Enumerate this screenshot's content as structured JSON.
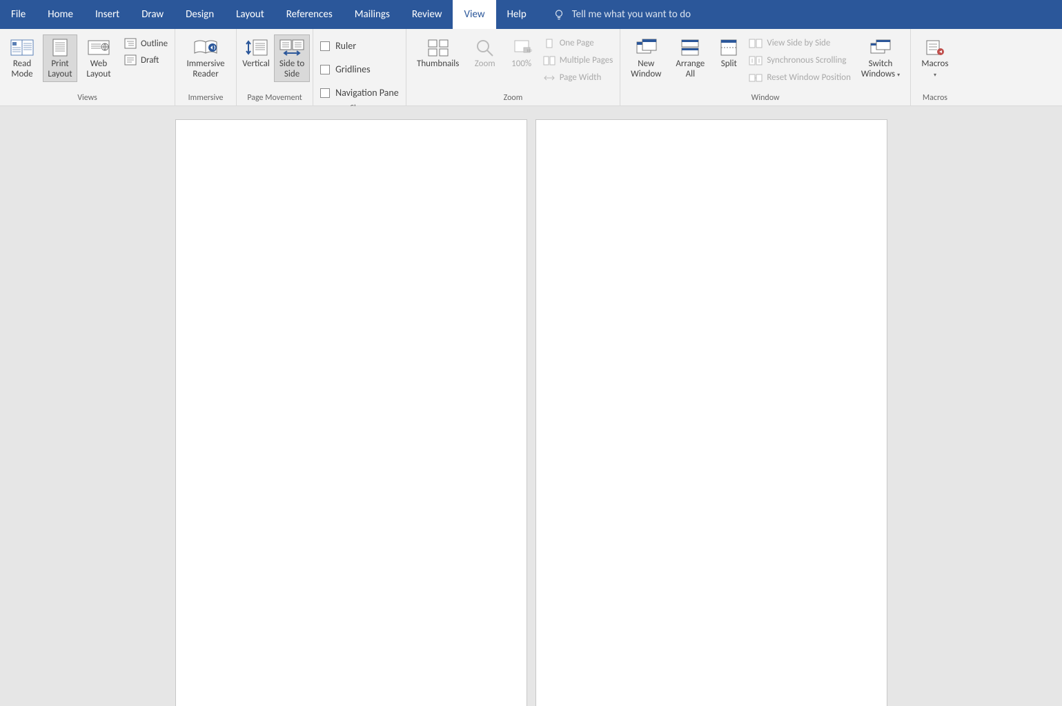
{
  "menubar": {
    "tabs": [
      "File",
      "Home",
      "Insert",
      "Draw",
      "Design",
      "Layout",
      "References",
      "Mailings",
      "Review",
      "View",
      "Help"
    ],
    "activeTab": "View",
    "tellme": "Tell me what you want to do"
  },
  "ribbon": {
    "views": {
      "read_mode": "Read Mode",
      "print_layout": "Print Layout",
      "web_layout": "Web Layout",
      "outline": "Outline",
      "draft": "Draft",
      "group": "Views"
    },
    "immersive": {
      "immersive_reader": "Immersive Reader",
      "group": "Immersive"
    },
    "page_movement": {
      "vertical": "Vertical",
      "side_to_side": "Side to Side",
      "group": "Page Movement"
    },
    "show": {
      "ruler": "Ruler",
      "gridlines": "Gridlines",
      "nav_pane": "Navigation Pane",
      "group": "Show"
    },
    "zoom": {
      "thumbnails": "Thumbnails",
      "zoom": "Zoom",
      "hundred": "100%",
      "one_page": "One Page",
      "multiple_pages": "Multiple Pages",
      "page_width": "Page Width",
      "group": "Zoom"
    },
    "window": {
      "new_window": "New Window",
      "arrange_all": "Arrange All",
      "split": "Split",
      "view_side_by_side": "View Side by Side",
      "sync_scroll": "Synchronous Scrolling",
      "reset_pos": "Reset Window Position",
      "switch_windows": "Switch Windows",
      "group": "Window"
    },
    "macros": {
      "macros": "Macros",
      "group": "Macros"
    }
  }
}
